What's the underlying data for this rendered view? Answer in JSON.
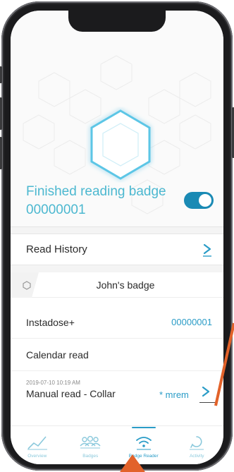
{
  "status": {
    "text": "Finished reading badge 00000001",
    "toggle_on": true
  },
  "read_history": {
    "label": "Read History"
  },
  "badge_card": {
    "name": "John's badge",
    "rows": [
      {
        "label": "Instadose+",
        "value": "00000001"
      },
      {
        "label": "Calendar read",
        "value": ""
      }
    ],
    "manual_read": {
      "date": "2019-07-10 10:19 AM",
      "label": "Manual read - Collar",
      "value": "* mrem"
    }
  },
  "nav": {
    "items": [
      {
        "label": "Overview",
        "icon": "chart-line-icon",
        "active": false
      },
      {
        "label": "Badges",
        "icon": "users-icon",
        "active": false
      },
      {
        "label": "Badge Reader",
        "icon": "wifi-icon",
        "active": true
      },
      {
        "label": "Activity",
        "icon": "activity-icon",
        "active": false
      }
    ]
  },
  "colors": {
    "accent": "#2a9cc7",
    "status_text": "#4cb8d0",
    "toggle": "#1a8ab4",
    "annotation_arrow": "#e2622a"
  }
}
